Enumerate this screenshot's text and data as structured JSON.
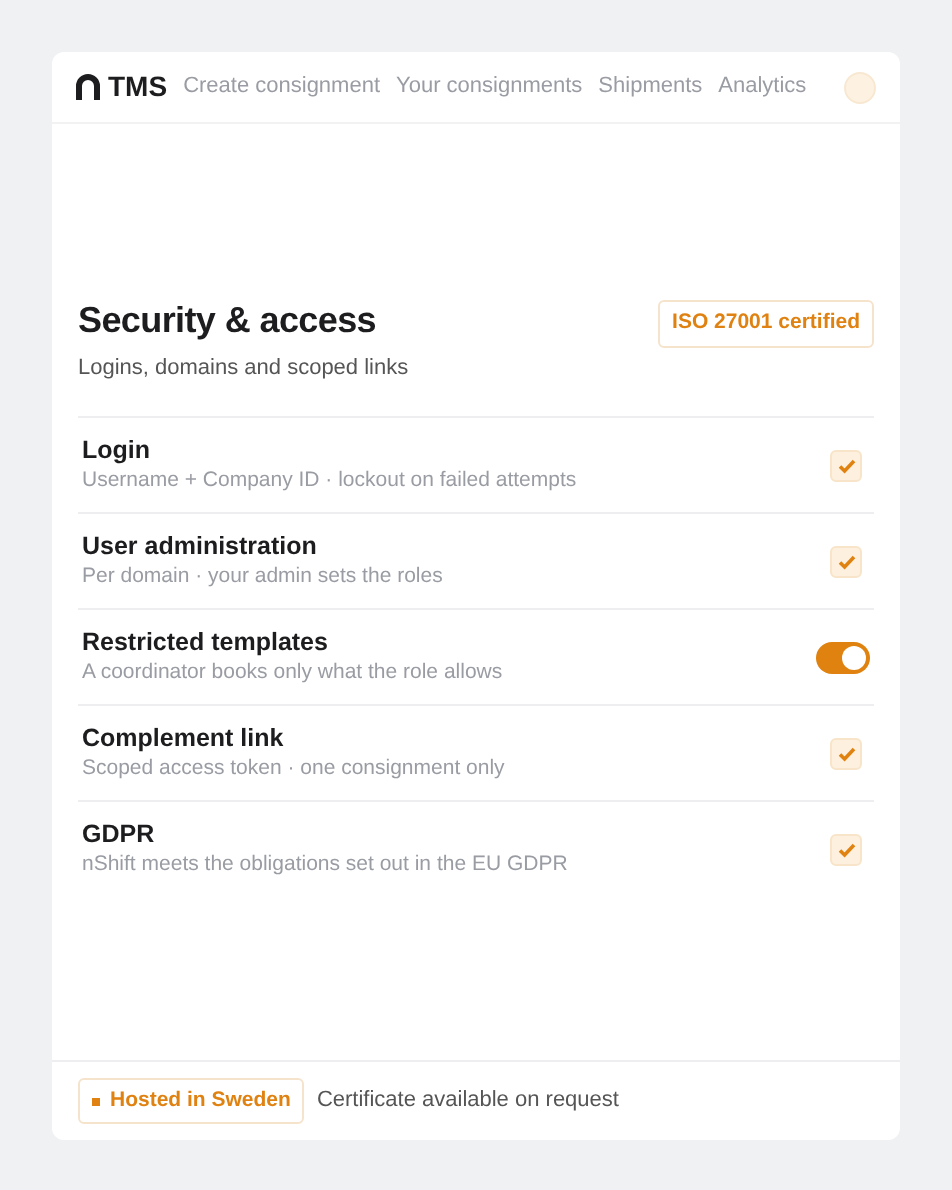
{
  "nav": {
    "brand": "TMS",
    "links": [
      {
        "label": "Create consignment"
      },
      {
        "label": "Your consignments"
      },
      {
        "label": "Shipments"
      },
      {
        "label": "Analytics"
      }
    ]
  },
  "section": {
    "title": "Security & access",
    "subtitle": "Logins, domains and scoped links",
    "badge": "ISO 27001 certified"
  },
  "rows": [
    {
      "kind": "check",
      "title": "Login",
      "detail": "Username + Company ID · lockout on failed attempts",
      "checked": true
    },
    {
      "kind": "check",
      "title": "User administration",
      "detail": "Per domain · your admin sets the roles",
      "checked": true
    },
    {
      "kind": "toggle",
      "title": "Restricted templates",
      "detail": "A coordinator books only what the role allows",
      "on": true
    },
    {
      "kind": "check",
      "title": "Complement link",
      "detail": "Scoped access token · one consignment only",
      "checked": true
    },
    {
      "kind": "check",
      "title": "GDPR",
      "detail": "nShift meets the obligations set out in the EU GDPR",
      "checked": true
    }
  ],
  "footer": {
    "tag": "Hosted in Sweden",
    "note": "Certificate available on request"
  }
}
